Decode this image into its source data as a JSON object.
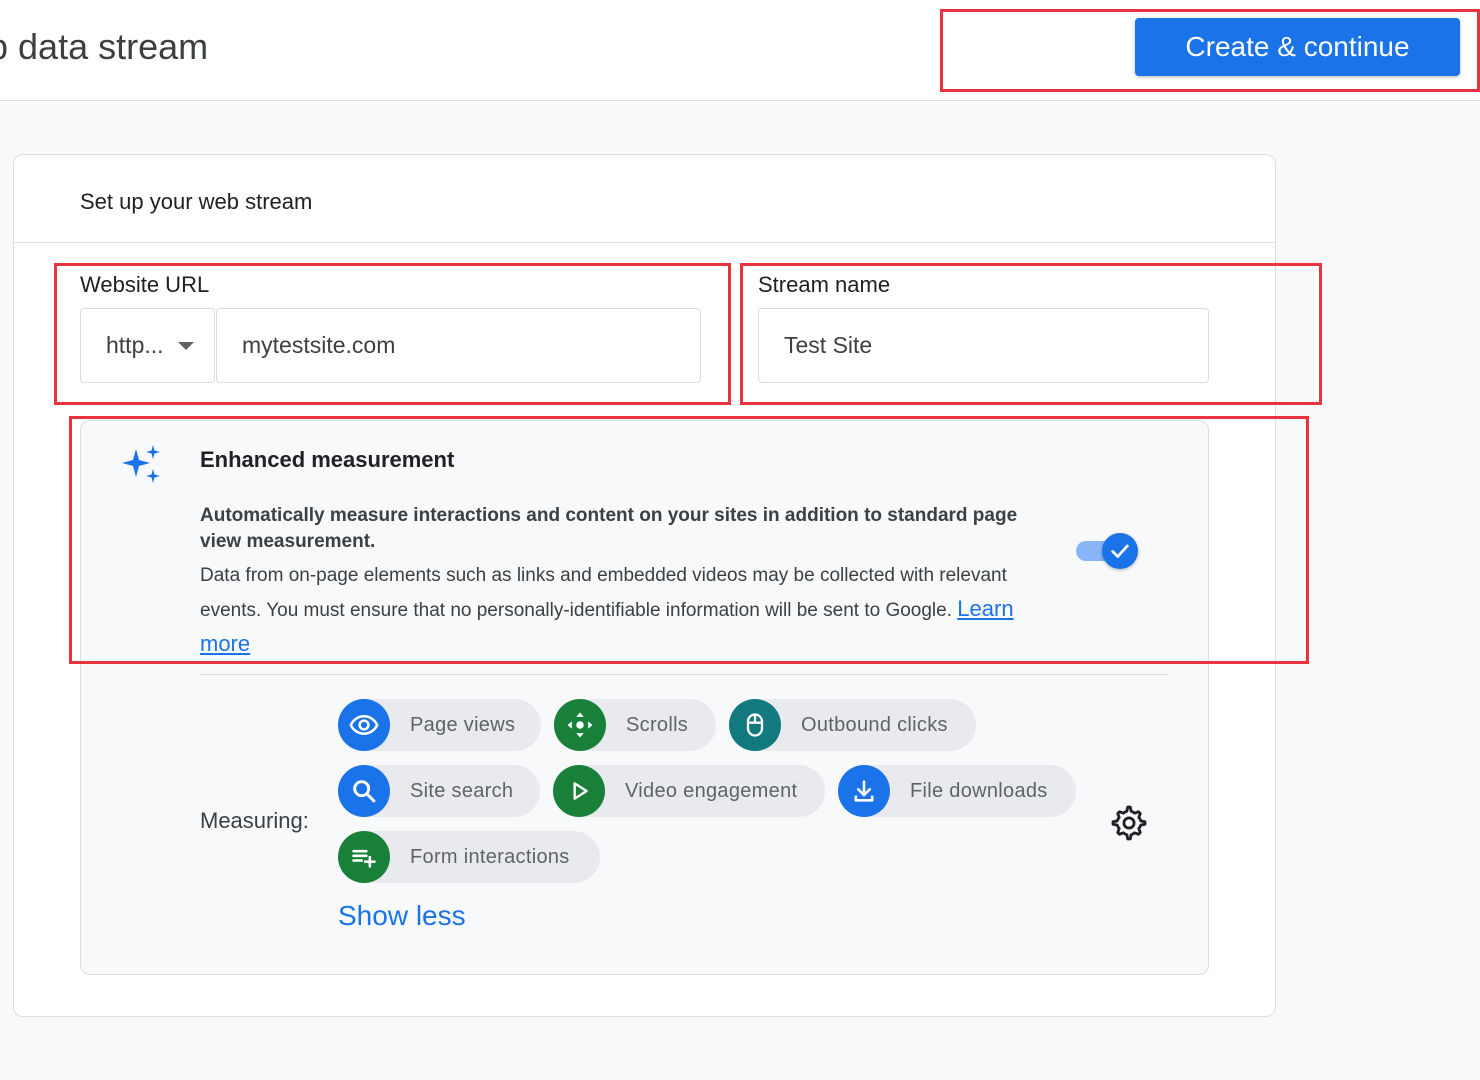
{
  "header": {
    "title": "p data stream",
    "create_label": "Create & continue"
  },
  "card": {
    "title": "Set up your web stream"
  },
  "website_url": {
    "label": "Website URL",
    "protocol": "http...",
    "value": "mytestsite.com"
  },
  "stream_name": {
    "label": "Stream name",
    "value": "Test Site"
  },
  "enhanced": {
    "title": "Enhanced measurement",
    "description_bold": "Automatically measure interactions and content on your sites in addition to standard page view measurement.",
    "description": "Data from on-page elements such as links and embedded videos may be collected with relevant events. You must ensure that no personally-identifiable information will be sent to Google.",
    "learn_more": "Learn more",
    "enabled": true
  },
  "measuring": {
    "label": "Measuring:",
    "chips": [
      {
        "label": "Page views",
        "icon": "eye-icon",
        "color": "#1a73e8"
      },
      {
        "label": "Scrolls",
        "icon": "scroll-arrows-icon",
        "color": "#188038"
      },
      {
        "label": "Outbound clicks",
        "icon": "mouse-icon",
        "color": "#12797f"
      },
      {
        "label": "Site search",
        "icon": "search-icon",
        "color": "#1a73e8"
      },
      {
        "label": "Video engagement",
        "icon": "play-icon",
        "color": "#188038"
      },
      {
        "label": "File downloads",
        "icon": "download-icon",
        "color": "#1a73e8"
      },
      {
        "label": "Form interactions",
        "icon": "playlist-add-icon",
        "color": "#188038"
      }
    ],
    "show_less": "Show less"
  },
  "colors": {
    "primary": "#1a73e8",
    "green": "#188038",
    "teal": "#12797f",
    "highlight": "#e8343e"
  }
}
